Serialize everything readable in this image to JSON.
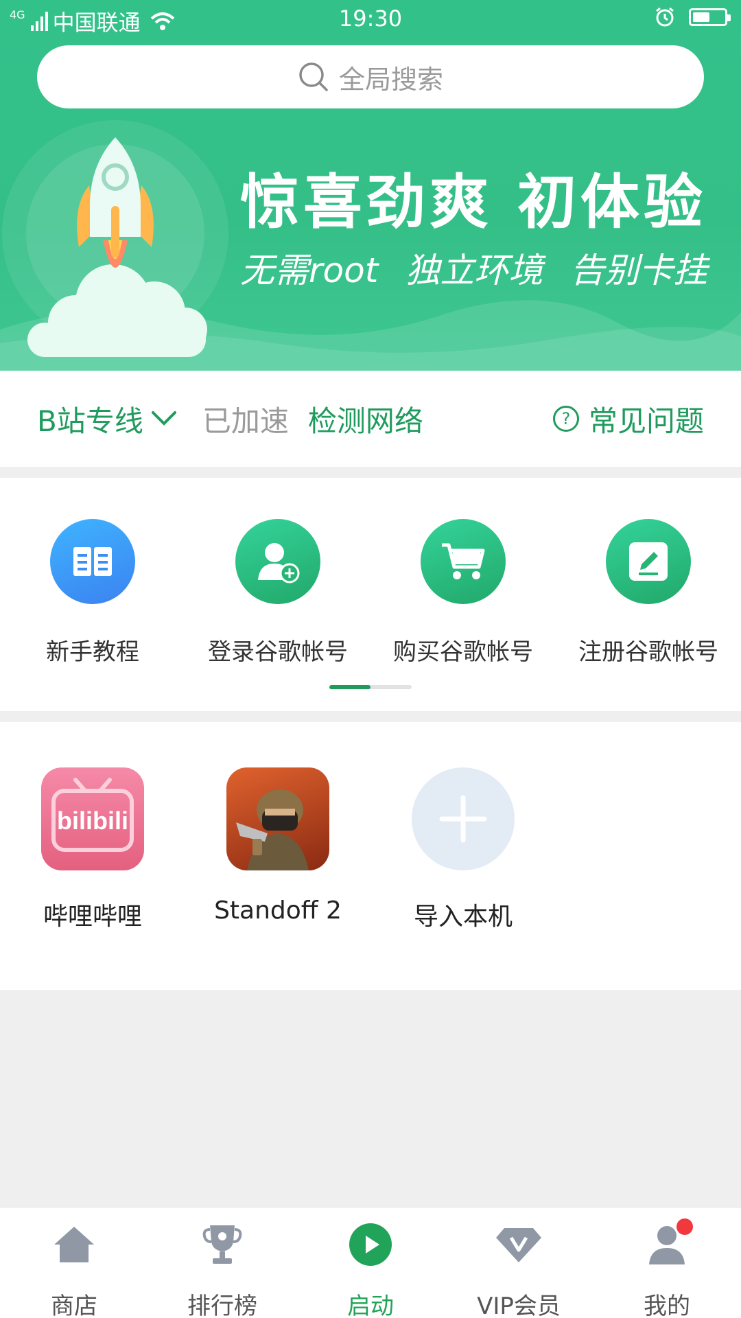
{
  "status_bar": {
    "network_type": "4G",
    "carrier": "中国联通",
    "time": "19:30",
    "battery_level": 0.55
  },
  "search": {
    "placeholder": "全局搜索"
  },
  "banner": {
    "title": "惊喜劲爽  初体验",
    "subtitle": "无需root  独立环境  告别卡挂"
  },
  "network_row": {
    "line_name": "B站专线",
    "status": "已加速",
    "detect_label": "检测网络",
    "faq_label": "常见问题"
  },
  "shortcuts": [
    {
      "label": "新手教程",
      "icon": "book-icon",
      "color": "#3d9bf5"
    },
    {
      "label": "登录谷歌帐号",
      "icon": "user-add-icon",
      "color": "#2ec27e"
    },
    {
      "label": "购买谷歌帐号",
      "icon": "cart-icon",
      "color": "#2ec27e"
    },
    {
      "label": "注册谷歌帐号",
      "icon": "edit-icon",
      "color": "#2ec27e"
    }
  ],
  "shortcut_pager": {
    "page": 1,
    "total": 2
  },
  "apps": [
    {
      "name": "哔哩哔哩",
      "icon": "bilibili-app-icon",
      "icon_text": "bilibili"
    },
    {
      "name": "Standoff 2",
      "icon": "standoff2-app-icon"
    },
    {
      "name": "导入本机",
      "icon": "plus-icon"
    }
  ],
  "bottom_nav": [
    {
      "label": "商店",
      "icon": "home-icon"
    },
    {
      "label": "排行榜",
      "icon": "trophy-icon"
    },
    {
      "label": "启动",
      "icon": "play-icon",
      "active": true
    },
    {
      "label": "VIP会员",
      "icon": "diamond-icon"
    },
    {
      "label": "我的",
      "icon": "profile-icon",
      "badge": true
    }
  ],
  "colors": {
    "brand_green": "#1f9b5d",
    "header_green": "#35bf88",
    "active_nav": "#21a35a",
    "badge_red": "#f0383d",
    "tutorial_blue": "#3d9bf5"
  }
}
